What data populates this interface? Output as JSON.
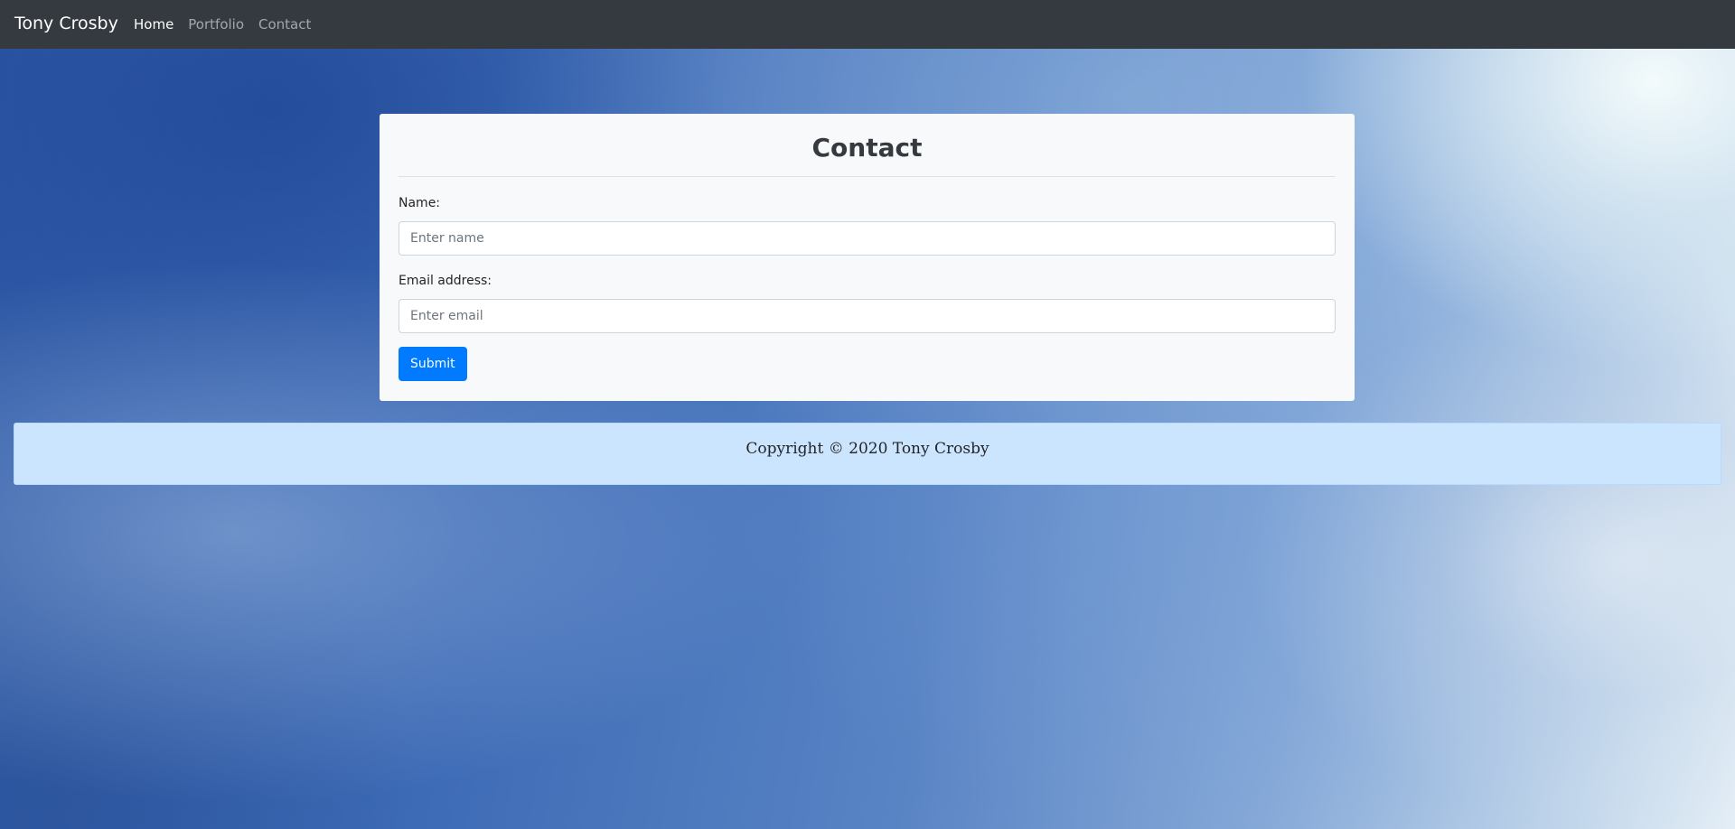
{
  "navbar": {
    "brand": "Tony Crosby",
    "links": [
      {
        "label": "Home",
        "active": true
      },
      {
        "label": "Portfolio",
        "active": false
      },
      {
        "label": "Contact",
        "active": false
      }
    ]
  },
  "contact_form": {
    "title": "Contact",
    "name": {
      "label": "Name:",
      "placeholder": "Enter name",
      "value": ""
    },
    "email": {
      "label": "Email address:",
      "placeholder": "Enter email",
      "value": ""
    },
    "submit_label": "Submit"
  },
  "footer": {
    "copyright": "Copyright © 2020 Tony Crosby"
  },
  "colors": {
    "navbar_bg": "#343a40",
    "card_bg": "#f8f9fa",
    "primary": "#007bff",
    "footer_bg": "#cce5ff",
    "footer_border": "#b8daff"
  }
}
